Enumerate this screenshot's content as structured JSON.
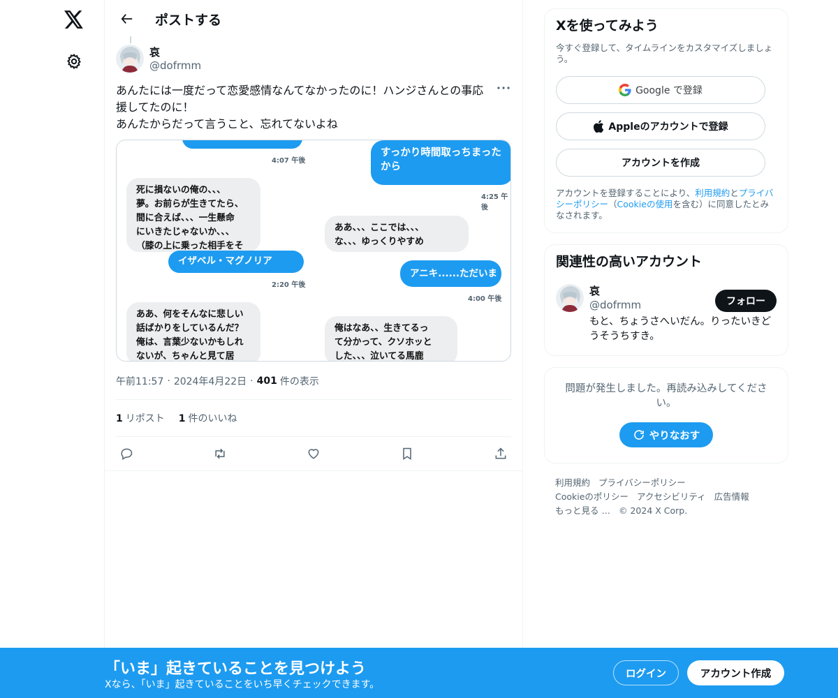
{
  "header": {
    "title": "ポストする"
  },
  "post": {
    "author_name": "哀",
    "author_handle": "@dofrmm",
    "text_lines": [
      "あんたには一度だって恋愛感情なんてなかったのに！ハンジさんとの事応",
      "援してたのに！",
      "あんたからだって言うこと、忘れてないよね"
    ],
    "media": {
      "top": {
        "ts1": "4:07 午後",
        "out1": "すっかり時間取っちまった\nから",
        "ts2": "4:25 午後",
        "in1": "死に損ないの俺の、、、\n夢。お前らが生きてたら、\n間に合えば、、、一生懸命\nにいきたじゃないか、、、\n（膝の上に乗った相手をそ",
        "in2": "ああ、、、ここでは、、、\nな、、、ゆっくりやすめ"
      },
      "bottom": {
        "out1": "イザベル・マグノリア",
        "ts1": "2:20 午後",
        "out2": "アニキ......ただいま",
        "ts2": "4:00 午後",
        "in1": "ああ、何をそんなに悲しい\n話ばかりをしているんだ？\n俺は、言葉少ないかもしれ\nないが、ちゃんと見て居",
        "in2": "俺はなあ、、生きてるっ\nて分かって、クソホッと\nした、、、泣いてる馬鹿"
      }
    },
    "time": "午前11:57",
    "date": "2024年4月22日",
    "views_count": "401",
    "views_label": "件の表示",
    "reposts_count": "1",
    "reposts_label": "リポスト",
    "likes_count": "1",
    "likes_label": "件のいいね"
  },
  "signup": {
    "title": "Xを使ってみよう",
    "subtitle": "今すぐ登録して、タイムラインをカスタマイズしましょう。",
    "google_label": "Google で登録",
    "apple_label": "Appleのアカウントで登録",
    "create_label": "アカウントを作成",
    "terms_1": "アカウントを登録することにより、",
    "terms_link_1": "利用規約",
    "terms_2": "と",
    "terms_link_2": "プライバシーポリシー",
    "terms_3": "（",
    "terms_link_3": "Cookieの使用",
    "terms_4": "を含む）に同意したとみなされます。"
  },
  "related": {
    "title": "関連性の高いアカウント",
    "name": "哀",
    "handle": "@dofrmm",
    "bio": "もと、ちょうさへいだん。りったいきどうそうちすき。",
    "follow_label": "フォロー"
  },
  "error": {
    "message": "問題が発生しました。再読み込みしてください。",
    "retry_label": "やりなおす"
  },
  "footer": {
    "terms": "利用規約",
    "privacy": "プライバシーポリシー",
    "cookie": "Cookieのポリシー",
    "accessibility": "アクセシビリティ",
    "ads": "広告情報",
    "more": "もっと見る …",
    "copyright": "© 2024 X Corp."
  },
  "banner": {
    "title": "「いま」起きていることを見つけよう",
    "subtitle": "Xなら、「いま」起きていることをいち早くチェックできます。",
    "login_label": "ログイン",
    "create_label": "アカウント作成"
  },
  "colors": {
    "accent": "#1d9bf0",
    "text": "#0f1419",
    "muted": "#536471"
  }
}
